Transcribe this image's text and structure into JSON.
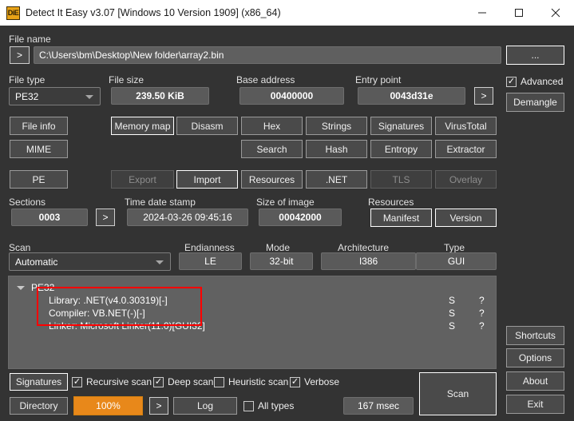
{
  "window": {
    "title": "Detect It Easy v3.07 [Windows 10 Version 1909] (x86_64)",
    "icon_label": "DiE",
    "minimize_icon": "minimize-icon",
    "maximize_icon": "maximize-icon",
    "close_icon": "close-icon"
  },
  "filename": {
    "label": "File name",
    "expand_button": ">",
    "value": "C:\\Users\\bm\\Desktop\\New folder\\array2.bin",
    "browse_button": "..."
  },
  "info": {
    "file_type_label": "File type",
    "file_type_value": "PE32",
    "file_size_label": "File size",
    "file_size_value": "239.50 KiB",
    "base_address_label": "Base address",
    "base_address_value": "00400000",
    "entry_point_label": "Entry point",
    "entry_point_value": "0043d31e",
    "entry_point_go_button": ">"
  },
  "advanced": {
    "checkbox_label": "Advanced",
    "checked": true,
    "demangle_button": "Demangle"
  },
  "tools_row1": [
    {
      "label": "File info",
      "disabled": false
    },
    {
      "label": "Memory map",
      "disabled": false
    },
    {
      "label": "Disasm",
      "disabled": false
    },
    {
      "label": "Hex",
      "disabled": false
    },
    {
      "label": "Strings",
      "disabled": false
    },
    {
      "label": "Signatures",
      "disabled": false
    },
    {
      "label": "VirusTotal",
      "disabled": false
    }
  ],
  "tools_row2": [
    {
      "label": "MIME",
      "disabled": false
    },
    {
      "label": "Search",
      "disabled": false
    },
    {
      "label": "Hash",
      "disabled": false
    },
    {
      "label": "Entropy",
      "disabled": false
    },
    {
      "label": "Extractor",
      "disabled": false
    }
  ],
  "tools_row3": [
    {
      "label": "PE",
      "disabled": false
    },
    {
      "label": "Export",
      "disabled": true
    },
    {
      "label": "Import",
      "disabled": false
    },
    {
      "label": "Resources",
      "disabled": false
    },
    {
      "label": ".NET",
      "disabled": false
    },
    {
      "label": "TLS",
      "disabled": true
    },
    {
      "label": "Overlay",
      "disabled": true
    }
  ],
  "sections": {
    "label": "Sections",
    "value": "0003",
    "go_button": ">",
    "timestamp_label": "Time date stamp",
    "timestamp_value": "2024-03-26 09:45:16",
    "size_of_image_label": "Size of image",
    "size_of_image_value": "00042000",
    "resources_label": "Resources",
    "manifest_button": "Manifest",
    "version_button": "Version"
  },
  "scan": {
    "label": "Scan",
    "mode_value": "Automatic",
    "endianness_label": "Endianness",
    "endianness_value": "LE",
    "mode_label": "Mode",
    "mode_bits_value": "32-bit",
    "architecture_label": "Architecture",
    "architecture_value": "I386",
    "type_label": "Type",
    "type_value": "GUI"
  },
  "results": {
    "root_label": "PE32",
    "rows": [
      {
        "name": "Library: .NET(v4.0.30319)[-]",
        "col1": "S",
        "col2": "?"
      },
      {
        "name": "Compiler: VB.NET(-)[-]",
        "col1": "S",
        "col2": "?"
      },
      {
        "name": "Linker: Microsoft Linker(11.0)[GUI32]",
        "col1": "S",
        "col2": "?"
      }
    ],
    "highlight_color": "#ff0000"
  },
  "bottom": {
    "signatures_button": "Signatures",
    "recursive_scan_label": "Recursive scan",
    "recursive_scan_checked": true,
    "deep_scan_label": "Deep scan",
    "deep_scan_checked": true,
    "heuristic_scan_label": "Heuristic scan",
    "heuristic_scan_checked": false,
    "verbose_label": "Verbose",
    "verbose_checked": true,
    "directory_button": "Directory",
    "progress_value": "100%",
    "progress_color": "#e8881a",
    "progress_expand_button": ">",
    "log_button": "Log",
    "all_types_label": "All types",
    "all_types_checked": false,
    "elapsed_value": "167 msec",
    "scan_button": "Scan"
  },
  "sidebar": {
    "shortcuts_button": "Shortcuts",
    "options_button": "Options",
    "about_button": "About",
    "exit_button": "Exit"
  }
}
